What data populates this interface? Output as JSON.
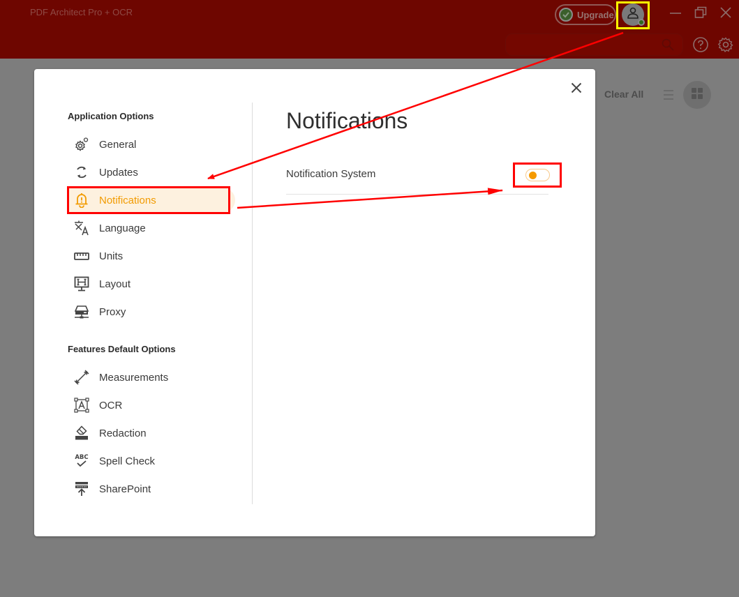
{
  "app": {
    "title": "PDF Architect Pro + OCR",
    "upgrade_label": "Upgrade",
    "account_icon": "user-icon",
    "account_status": "online",
    "window_controls": [
      "minimize-icon",
      "restore-icon",
      "close-icon"
    ],
    "search": {
      "placeholder": "",
      "value": ""
    },
    "header_icons": [
      "help-icon",
      "gear-icon"
    ]
  },
  "background_panel": {
    "clear_all_label": "Clear All",
    "view_icons": [
      "list-view-icon",
      "grid-view-icon"
    ]
  },
  "modal": {
    "close_icon": "close-icon",
    "sections": [
      {
        "title": "Application Options",
        "items": [
          {
            "label": "General",
            "icon": "gears-icon"
          },
          {
            "label": "Updates",
            "icon": "refresh-icon"
          },
          {
            "label": "Notifications",
            "icon": "bell-alert-icon",
            "active": true
          },
          {
            "label": "Language",
            "icon": "translate-icon"
          },
          {
            "label": "Units",
            "icon": "ruler-icon"
          },
          {
            "label": "Layout",
            "icon": "monitor-layout-icon"
          },
          {
            "label": "Proxy",
            "icon": "network-drive-icon"
          }
        ]
      },
      {
        "title": "Features Default Options",
        "items": [
          {
            "label": "Measurements",
            "icon": "measure-arrow-icon"
          },
          {
            "label": "OCR",
            "icon": "ocr-text-icon"
          },
          {
            "label": "Redaction",
            "icon": "eraser-icon"
          },
          {
            "label": "Spell Check",
            "icon": "spellcheck-icon"
          },
          {
            "label": "SharePoint",
            "icon": "upload-server-icon"
          }
        ]
      }
    ],
    "content": {
      "title": "Notifications",
      "settings": [
        {
          "label": "Notification System",
          "type": "toggle",
          "enabled": false
        }
      ]
    }
  },
  "colors": {
    "accent": "#f59a00",
    "active_bg": "#fdf1df",
    "titlebar": "#6e0600",
    "annotation_red": "#ff0000",
    "annotation_yellow": "#ffff00"
  }
}
